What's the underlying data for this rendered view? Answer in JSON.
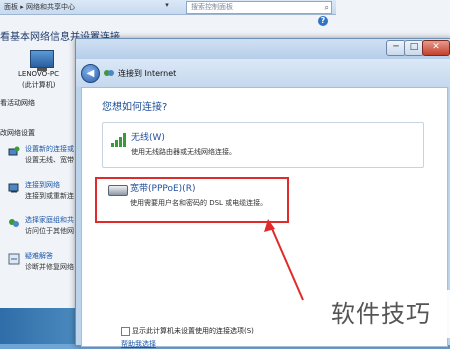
{
  "background_window": {
    "breadcrumb": "面板 ▸ 网络和共享中心",
    "dropdown_glyph": "▾",
    "search_placeholder": "搜索控制面板",
    "help_glyph": "?",
    "heading": "看基本网络信息并设置连接",
    "computer_name": "LENOVO-PC",
    "computer_sub": "(此计算机)",
    "active_networks_label": "看活动网络",
    "change_settings_label": "改网络设置",
    "items": [
      {
        "link": "设置新的连接或",
        "desc": "设置无线、宽带"
      },
      {
        "link": "连接到网络",
        "desc": "连接到或重新连"
      },
      {
        "link": "选择家庭组和共",
        "desc": "访问位于其他网"
      },
      {
        "link": "疑难解答",
        "desc": "诊断并修复网络"
      }
    ]
  },
  "dialog": {
    "min_glyph": "─",
    "max_glyph": "□",
    "close_glyph": "✕",
    "back_glyph": "◀",
    "nav_title": "连接到 Internet",
    "question": "您想如何连接?",
    "options": [
      {
        "title": "无线(W)",
        "desc": "使用无线路由器或无线网络连接。"
      },
      {
        "title": "宽带(PPPoE)(R)",
        "desc": "使用需要用户名和密码的 DSL 或电缆连接。"
      }
    ],
    "show_options_label": "显示此计算机未设置使用的连接选项(S)",
    "help_link": "帮助我选择"
  },
  "watermark": "软件技巧",
  "colors": {
    "highlight": "#e02b2b",
    "link": "#1a55a8",
    "heading_blue": "#1f4f99"
  }
}
